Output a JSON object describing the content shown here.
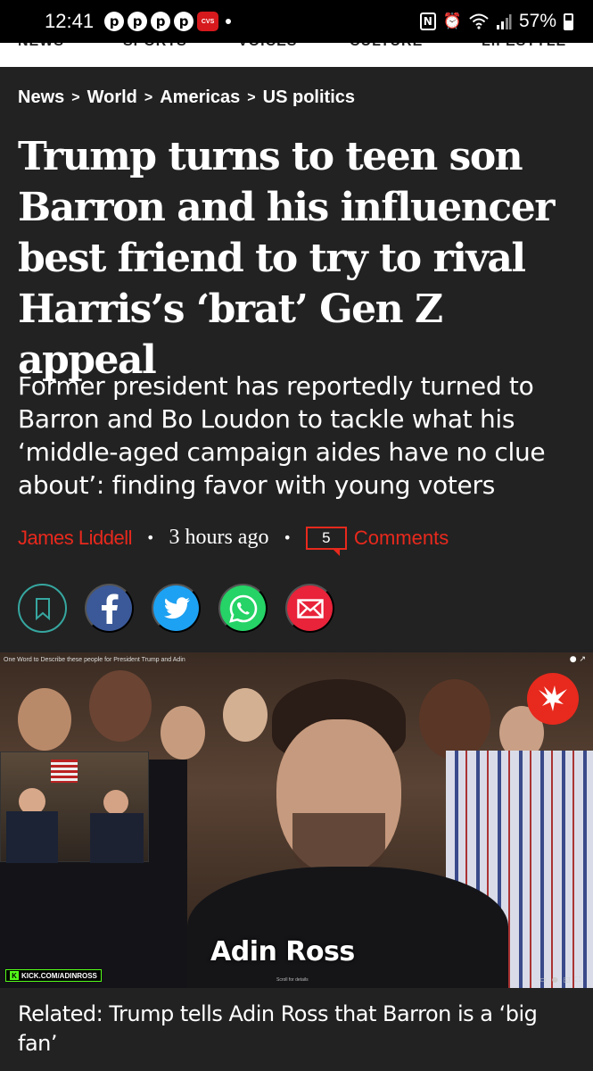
{
  "status_bar": {
    "time": "12:41",
    "notifications": [
      "pinterest-icon",
      "pinterest-icon",
      "pinterest-icon",
      "pinterest-icon",
      "cvs-pharmacy-icon"
    ],
    "cvs_label": "CVS",
    "battery": "57%",
    "nfc_label": "N"
  },
  "section_nav": {
    "items": [
      "NEWS",
      "SPORTS",
      "VOICES",
      "CULTURE",
      "LIFESTYLE"
    ]
  },
  "breadcrumb": {
    "items": [
      "News",
      "World",
      "Americas",
      "US politics"
    ],
    "separator": ">"
  },
  "article": {
    "headline": "Trump turns to teen son Barron and his influencer best friend to try to rival Harris’s ‘brat’ Gen Z appeal",
    "standfirst": "Former president has reportedly turned to Barron and Bo Loudon to tackle what his ‘middle-aged campaign aides have no clue about’: finding favor with young voters",
    "author": "James Liddell",
    "time_ago": "3 hours ago",
    "comment_count": "5",
    "comments_label": "Comments",
    "bullet": "•"
  },
  "share": {
    "buttons": [
      "bookmark-icon",
      "facebook-icon",
      "twitter-icon",
      "whatsapp-icon",
      "email-icon"
    ]
  },
  "video": {
    "title": "One Word to Describe these people for President Trump and Adin",
    "name_caption": "Adin Ross",
    "kick_url": "KICK.COM/ADINROSS",
    "kick_letter": "K",
    "scroll_hint": "Scroll for details"
  },
  "related": {
    "text": "Related: Trump tells Adin Ross that Barron is a ‘big fan’"
  },
  "colors": {
    "background": "#222222",
    "accent_red": "#e8291d",
    "bookmark_teal": "#36a7a0",
    "facebook": "#3b5998",
    "twitter": "#1da1f2",
    "whatsapp": "#25d366",
    "email": "#e8233a"
  }
}
